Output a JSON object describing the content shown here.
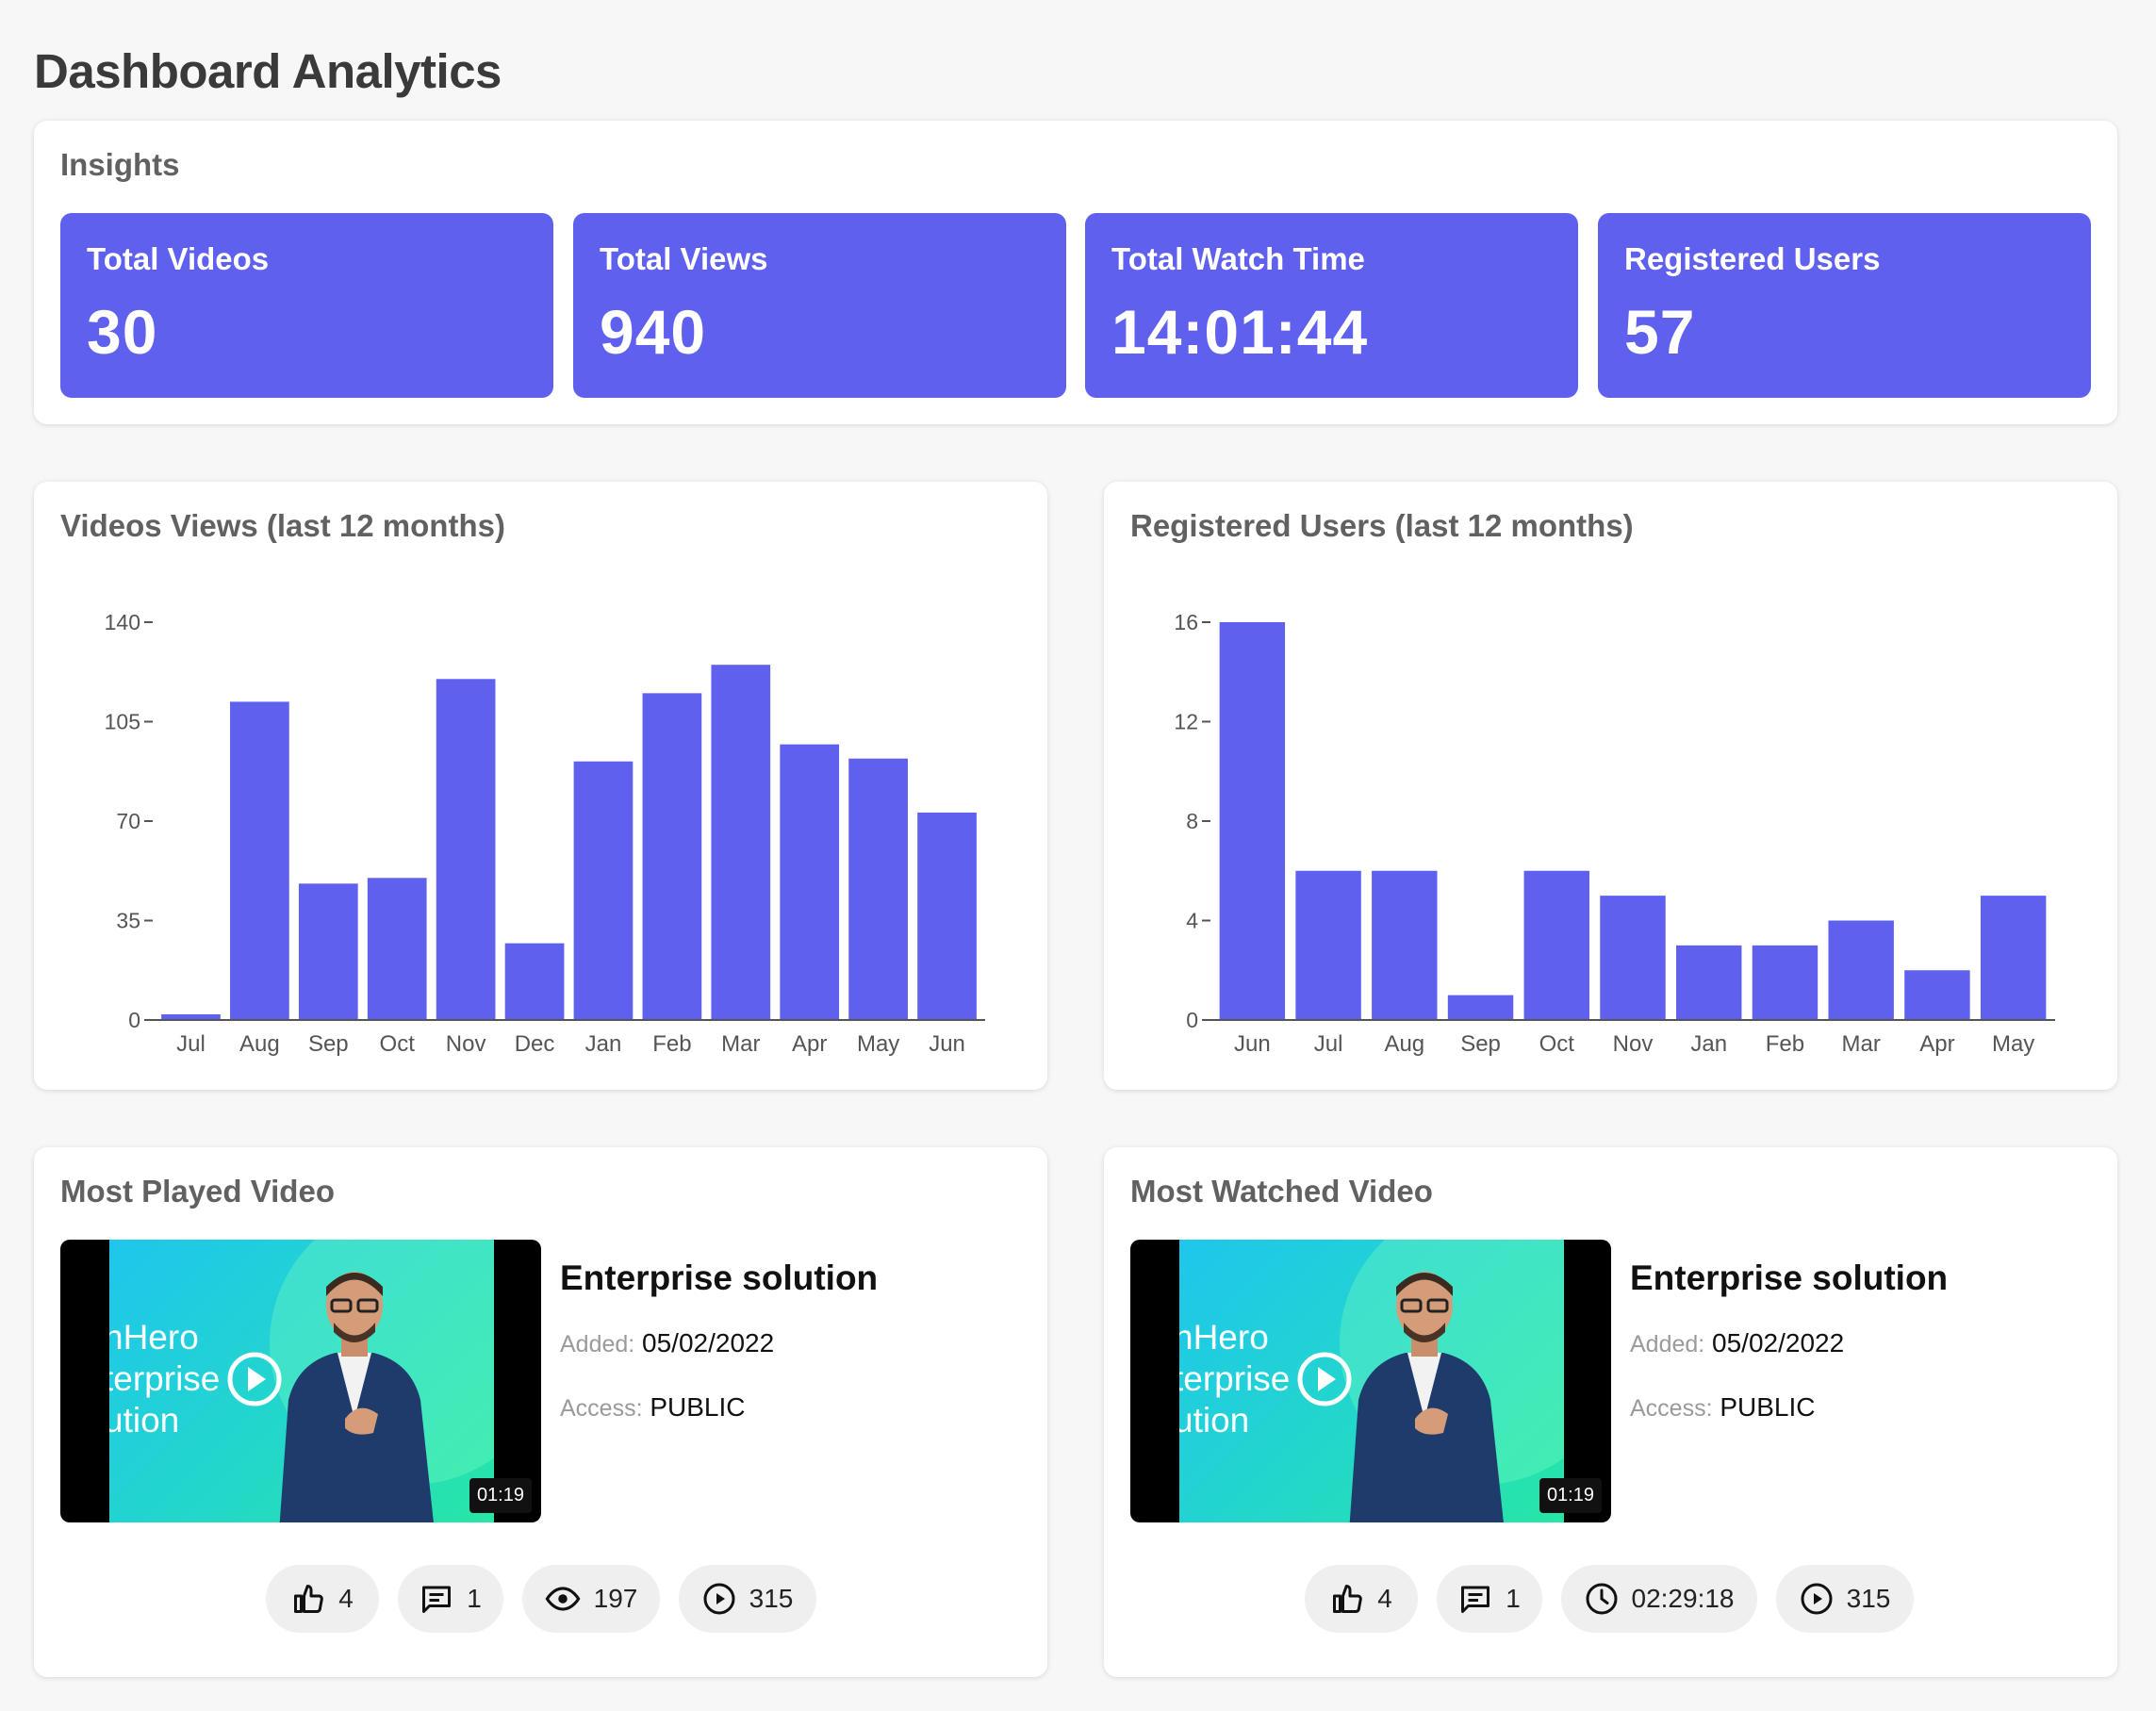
{
  "page": {
    "title": "Dashboard Analytics"
  },
  "insights": {
    "title": "Insights",
    "kpis": [
      {
        "label": "Total Videos",
        "value": "30"
      },
      {
        "label": "Total Views",
        "value": "940"
      },
      {
        "label": "Total Watch Time",
        "value": "14:01:44"
      },
      {
        "label": "Registered Users",
        "value": "57"
      }
    ]
  },
  "views_chart": {
    "title": "Videos Views (last 12 months)"
  },
  "users_chart": {
    "title": "Registered Users (last 12 months)"
  },
  "chart_data": [
    {
      "type": "bar",
      "title": "Videos Views (last 12 months)",
      "categories": [
        "Jul",
        "Aug",
        "Sep",
        "Oct",
        "Nov",
        "Dec",
        "Jan",
        "Feb",
        "Mar",
        "Apr",
        "May",
        "Jun"
      ],
      "values": [
        2,
        112,
        48,
        50,
        120,
        27,
        91,
        115,
        125,
        97,
        92,
        73
      ],
      "yticks": [
        0,
        35,
        70,
        105,
        140
      ],
      "ylim": [
        0,
        140
      ],
      "color": "#5f60ee",
      "grid": false
    },
    {
      "type": "bar",
      "title": "Registered Users (last 12 months)",
      "categories": [
        "Jun",
        "Jul",
        "Aug",
        "Sep",
        "Oct",
        "Nov",
        "Jan",
        "Feb",
        "Mar",
        "Apr",
        "May"
      ],
      "values": [
        16,
        6,
        6,
        1,
        6,
        5,
        3,
        3,
        4,
        2,
        5
      ],
      "yticks": [
        0,
        4,
        8,
        12,
        16
      ],
      "ylim": [
        0,
        16
      ],
      "color": "#5f60ee",
      "grid": false
    }
  ],
  "most_played": {
    "title": "Most Played Video",
    "thumb_text": "nHero\nterprise\nution",
    "duration": "01:19",
    "video_title": "Enterprise solution",
    "added_label": "Added:",
    "added_value": "05/02/2022",
    "access_label": "Access:",
    "access_value": "PUBLIC",
    "stats": {
      "likes": "4",
      "comments": "1",
      "views": "197",
      "plays": "315"
    }
  },
  "most_watched": {
    "title": "Most Watched Video",
    "thumb_text": "nHero\nterprise\nution",
    "duration": "01:19",
    "video_title": "Enterprise solution",
    "added_label": "Added:",
    "added_value": "05/02/2022",
    "access_label": "Access:",
    "access_value": "PUBLIC",
    "stats": {
      "likes": "4",
      "comments": "1",
      "watch_time": "02:29:18",
      "plays": "315"
    }
  },
  "colors": {
    "accent": "#5f60ee",
    "background": "#f7f7f7",
    "card": "#ffffff"
  },
  "icons": [
    "thumbs-up-icon",
    "comment-icon",
    "eye-icon",
    "clock-icon",
    "play-circle-icon"
  ]
}
